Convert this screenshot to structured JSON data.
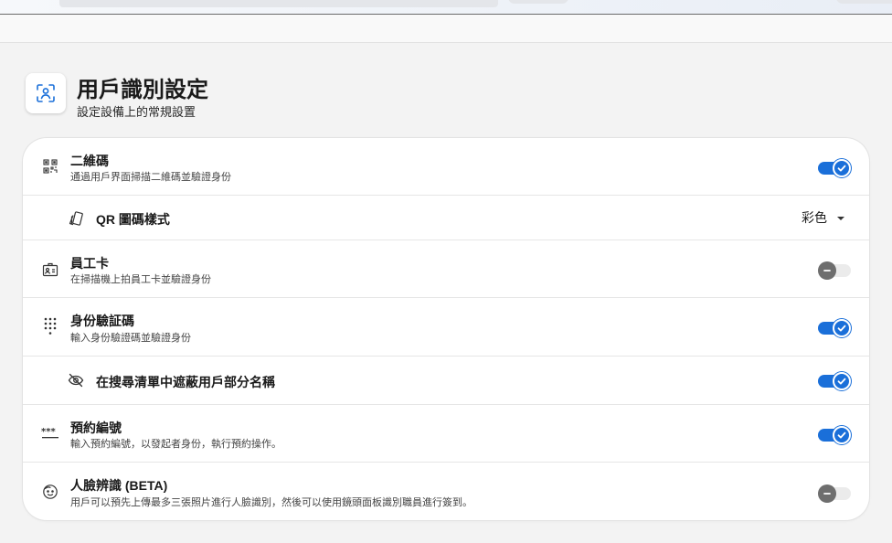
{
  "header": {
    "title": "用戶識別設定",
    "subtitle": "設定設備上的常規設置",
    "icon": "user-scan-icon"
  },
  "settings": {
    "qr": {
      "label": "二維碼",
      "desc": "通過用戶界面掃描二維碼並驗證身份",
      "enabled": true,
      "icon": "qr-code-icon"
    },
    "qr_style": {
      "label": "QR 圖碼樣式",
      "value": "彩色",
      "icon": "style-cards-icon"
    },
    "badge": {
      "label": "員工卡",
      "desc": "在掃描機上拍員工卡並驗證身份",
      "enabled": false,
      "icon": "id-card-icon"
    },
    "pin": {
      "label": "身份驗証碼",
      "desc": "輸入身份驗證碼並驗證身份",
      "enabled": true,
      "icon": "keypad-icon"
    },
    "mask": {
      "label": "在搜尋清單中遮蔽用戶部分名稱",
      "enabled": true,
      "icon": "eye-off-icon"
    },
    "booking": {
      "label": "預約編號",
      "desc": "輸入預約編號，以發起者身份，執行預約操作。",
      "enabled": true,
      "icon": "password-dots-icon"
    },
    "face": {
      "label": "人臉辨識 (BETA)",
      "desc": "用戶可以預先上傳最多三張照片進行人臉識別，然後可以使用鏡頭面板識別職員進行簽到。",
      "enabled": false,
      "icon": "face-icon"
    }
  },
  "colors": {
    "accent": "#1a6fd9",
    "toggle_off_knob": "#6e6e6e",
    "toggle_off_track": "#ebebeb",
    "page_bg": "#f3f3f3"
  }
}
